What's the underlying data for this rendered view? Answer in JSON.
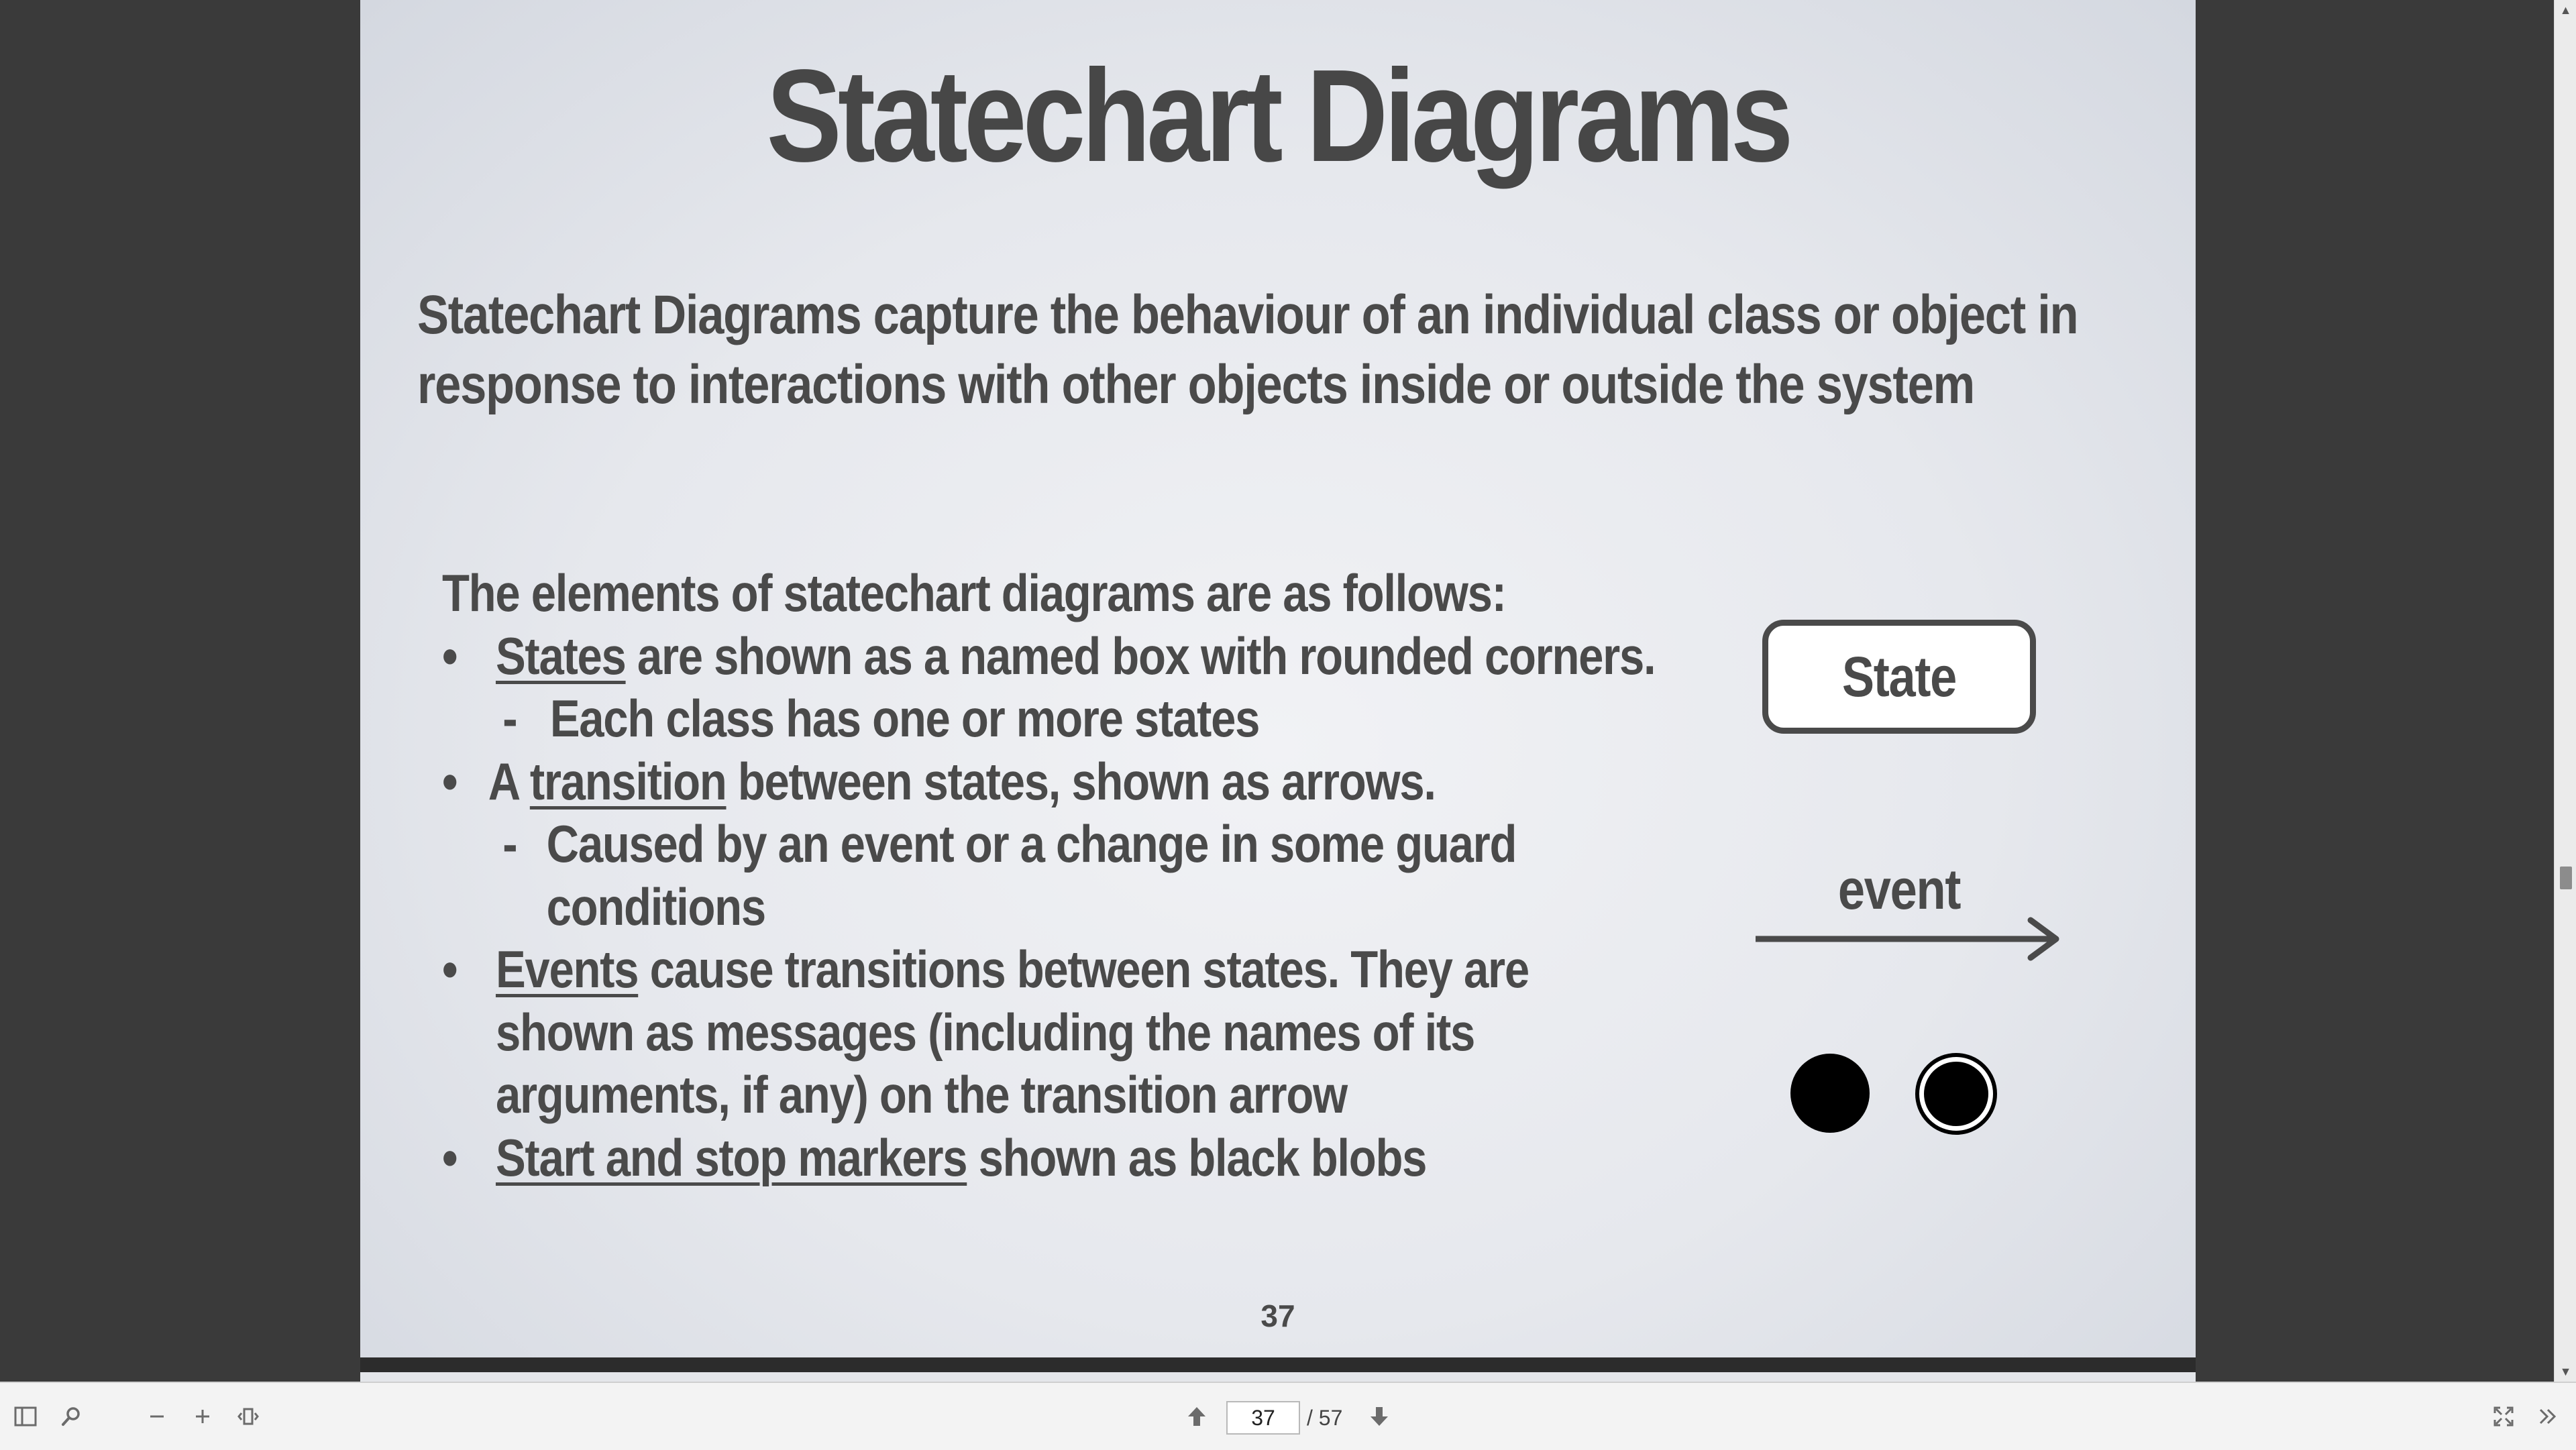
{
  "slide": {
    "title": "Statechart Diagrams",
    "intro": "Statechart Diagrams capture the behaviour of an individual class or object in response to interactions with other objects inside or outside the system",
    "elements_heading": "The elements of statechart diagrams are as follows:",
    "bullets": {
      "states": {
        "term": "States",
        "rest": " are shown as a named box with rounded corners.",
        "sub": "Each class has one or more states"
      },
      "transition": {
        "prefix": "A ",
        "term": "transition",
        "rest": " between states, shown as arrows.",
        "sub_line1": "Caused by an event or a change in some guard",
        "sub_line2": "conditions"
      },
      "events": {
        "term": "Events",
        "rest_line1": " cause transitions between states. They are",
        "line2": "shown as messages (including the names of its",
        "line3": "arguments, if any) on the transition arrow"
      },
      "markers": {
        "term": "Start and stop markers",
        "rest": " shown as black blobs"
      }
    },
    "bullet_symbol": "•",
    "dash_symbol": "-",
    "state_label": "State",
    "event_label": "event",
    "page_number": "37"
  },
  "toolbar": {
    "current_page": "37",
    "total_pages": "/ 57",
    "icons": {
      "sidebar": "sidebar-toggle-icon",
      "search": "search-icon",
      "zoom_out": "minus-icon",
      "zoom_in": "plus-icon",
      "fit": "fit-width-icon",
      "prev": "arrow-up-icon",
      "next": "arrow-down-icon",
      "fullscreen": "fullscreen-icon",
      "more": "double-chevron-right-icon"
    }
  },
  "colors": {
    "viewer_background": "#3a3a3a",
    "slide_text": "#4a4a4a",
    "toolbar_background": "#f3f3f3"
  }
}
